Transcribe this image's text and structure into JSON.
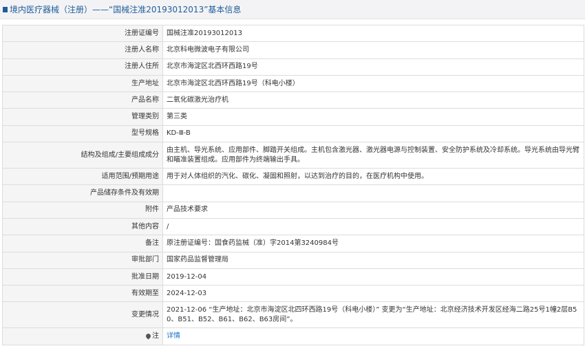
{
  "header": {
    "title": "境内医疗器械（注册）——“国械注准20193012013”基本信息"
  },
  "rows": [
    {
      "label": "注册证编号",
      "value": "国械注准20193012013"
    },
    {
      "label": "注册人名称",
      "value": "北京科电微波电子有限公司"
    },
    {
      "label": "注册人住所",
      "value": "北京市海淀区北西环西路19号"
    },
    {
      "label": "生产地址",
      "value": "北京市海淀区北西环西路19号（科电小楼）"
    },
    {
      "label": "产品名称",
      "value": "二氧化碳激光治疗机"
    },
    {
      "label": "管理类别",
      "value": "第三类"
    },
    {
      "label": "型号规格",
      "value": "KD-Ⅲ-B"
    },
    {
      "label": "结构及组成/主要组成成分",
      "value": "由主机、导光系统、应用部件、脚踏开关组成。主机包含激光器、激光器电源与控制装置、安全防护系统及冷却系统。导光系统由导光臂和瞄准装置组成。应用部件为终端输出手具。"
    },
    {
      "label": "适用范围/预期用途",
      "value": "用于对人体组织的汽化、碳化、凝固和照射，以达到治疗的目的，在医疗机构中使用。"
    },
    {
      "label": "产品储存条件及有效期",
      "value": ""
    },
    {
      "label": "附件",
      "value": "产品技术要求"
    },
    {
      "label": "其他内容",
      "value": "/"
    },
    {
      "label": "备注",
      "value": "原注册证编号：国食药监械（准）字2014第3240984号"
    },
    {
      "label": "审批部门",
      "value": "国家药品监督管理局"
    },
    {
      "label": "批准日期",
      "value": "2019-12-04"
    },
    {
      "label": "有效期至",
      "value": "2024-12-03"
    },
    {
      "label": "变更情况",
      "value": "2021-12-06 “生产地址：北京市海淀区北四环西路19号（科电小楼）” 变更为“生产地址：北京经济技术开发区经海二路25号1幢2层B50、B51、B52、B61、B62、B63房间”。"
    }
  ],
  "note": {
    "label": "注",
    "link_text": "详情",
    "icon": "pin-icon"
  },
  "colors": {
    "header_text": "#1f5d99",
    "label_bg": "#f5f5f5",
    "border": "#dcdcdc",
    "link": "#1a73c8"
  }
}
